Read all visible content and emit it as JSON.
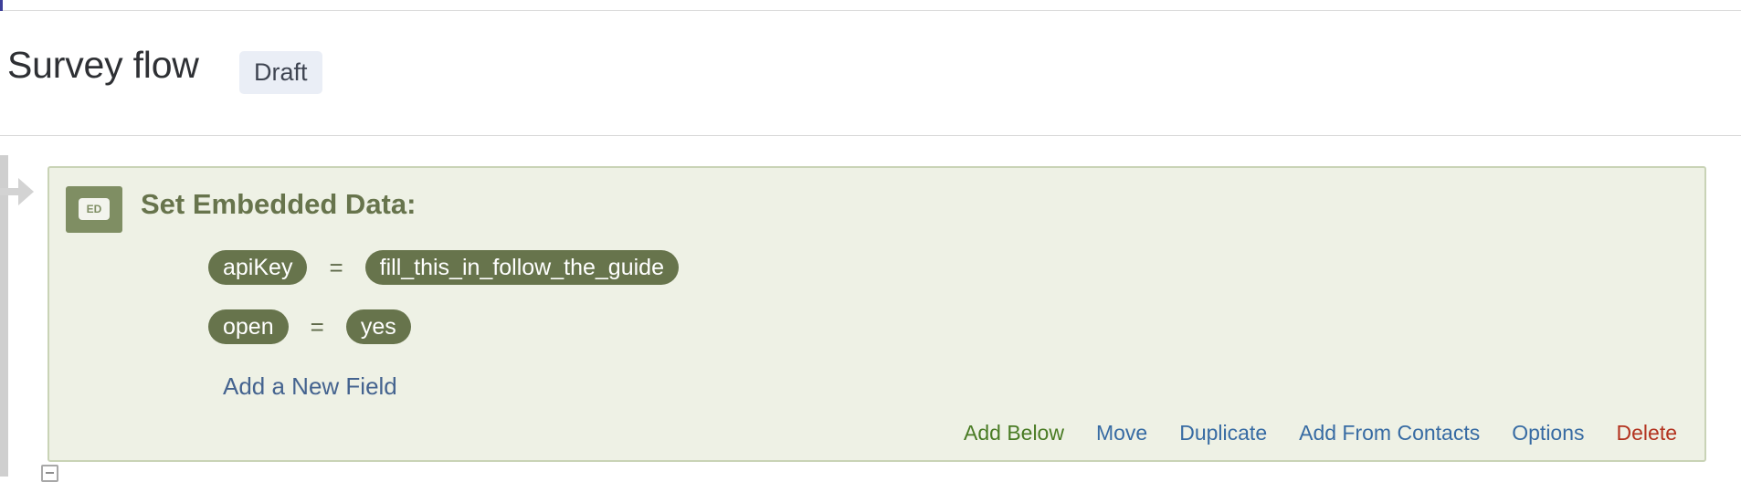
{
  "header": {
    "title": "Survey flow",
    "status": "Draft"
  },
  "block": {
    "icon_label": "ED",
    "title": "Set Embedded Data:",
    "fields": [
      {
        "key": "apiKey",
        "operator": "=",
        "value": "fill_this_in_follow_the_guide"
      },
      {
        "key": "open",
        "operator": "=",
        "value": "yes"
      }
    ],
    "add_field_label": "Add a New Field",
    "actions": {
      "add_below": "Add Below",
      "move": "Move",
      "duplicate": "Duplicate",
      "add_from_contacts": "Add From Contacts",
      "options": "Options",
      "delete": "Delete"
    }
  },
  "icons": {
    "flow_arrow": "arrow-right-icon",
    "collapse": "collapse-toggle-icon",
    "embedded_data": "embedded-data-icon"
  },
  "colors": {
    "block_background": "#eef1e5",
    "block_accent": "#67744c",
    "link_blue": "#376ba3",
    "add_below_green": "#497b24",
    "delete_red": "#b3331f"
  }
}
